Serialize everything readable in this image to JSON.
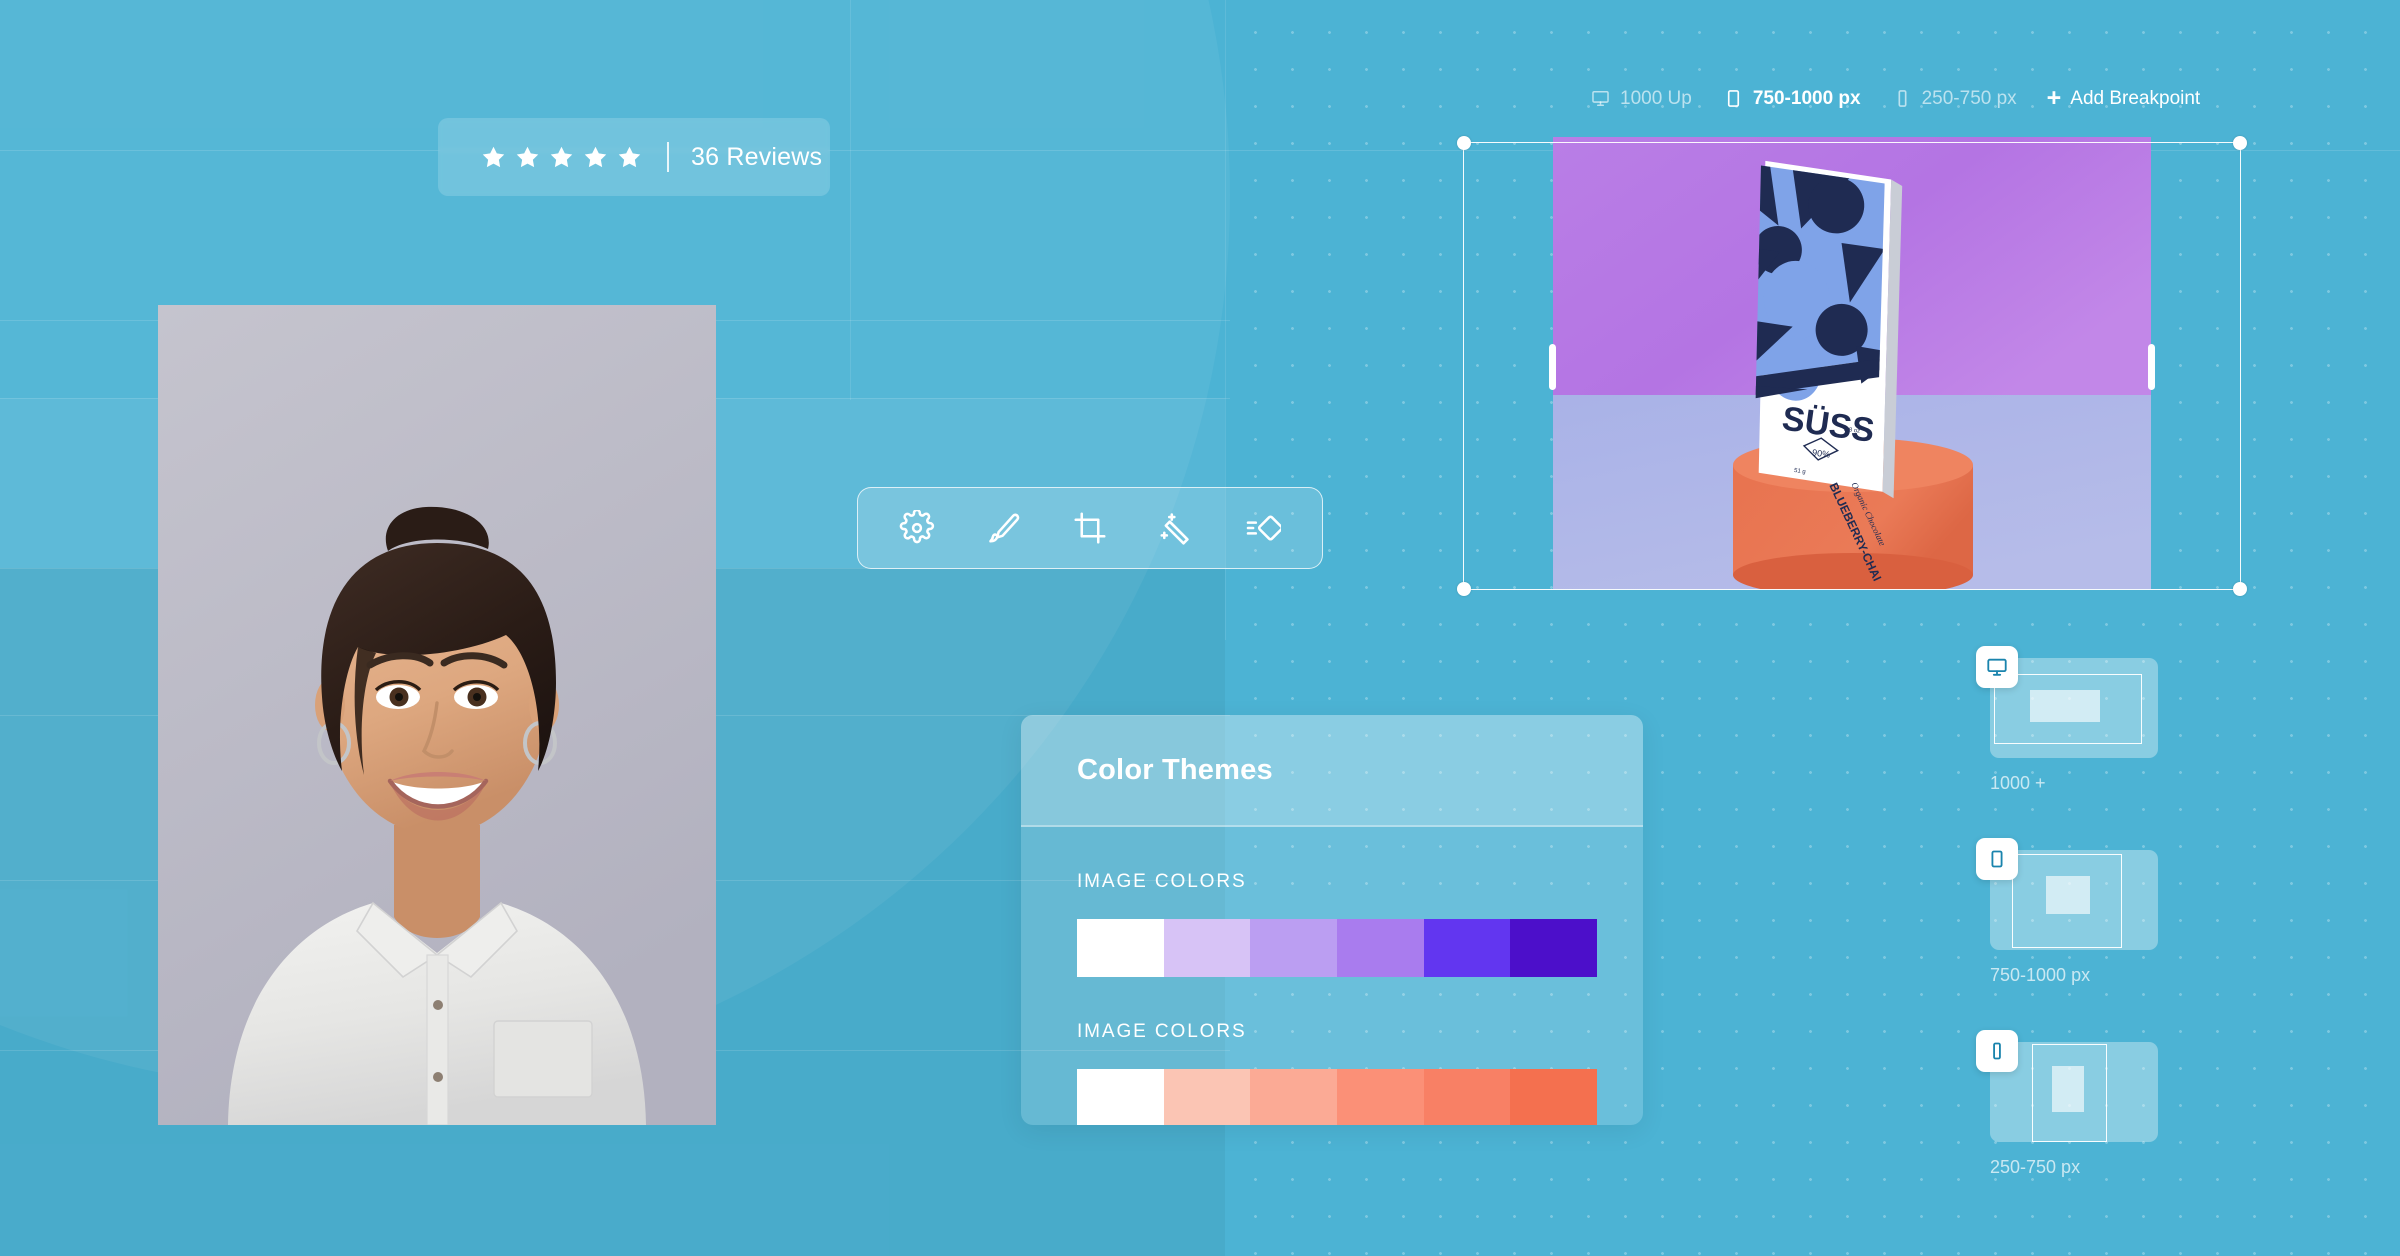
{
  "theme": {
    "background": "#4cb3d4",
    "panel_overlay": "rgba(255,255,255,0.17)",
    "accent_icon": "#1a84ad",
    "text_on_blue": "#ffffff"
  },
  "reviews_badge": {
    "star_count": 5,
    "star_icon": "star-icon",
    "divider": "|",
    "text": "36 Reviews"
  },
  "portrait": {
    "alt": "Smiling woman in light grey denim shirt on grey background",
    "background": "#bdbcc8"
  },
  "edit_toolbar": {
    "tools": [
      {
        "icon": "settings-gear-icon",
        "label": "Settings"
      },
      {
        "icon": "paint-brush-icon",
        "label": "Brush"
      },
      {
        "icon": "crop-icon",
        "label": "Crop"
      },
      {
        "icon": "magic-wand-icon",
        "label": "Magic Wand"
      },
      {
        "icon": "adjust-filter-icon",
        "label": "Adjust"
      }
    ]
  },
  "breakpoint_bar": {
    "items": [
      {
        "icon": "desktop-monitor-icon",
        "label": "1000 Up",
        "active": false
      },
      {
        "icon": "tablet-icon",
        "label": "750-1000 px",
        "active": true
      },
      {
        "icon": "mobile-phone-icon",
        "label": "250-750 px",
        "active": false
      }
    ],
    "add": {
      "plus": "+",
      "label": "Add Breakpoint"
    }
  },
  "canvas": {
    "product": {
      "brand": "SÜSS",
      "flavor": "BLUEBERRY-CHAI",
      "subtitle": "Organic Chocolate",
      "cacao": "90%",
      "weight": "1.8 oz",
      "net": "51 g",
      "backdrop_top": "#b277e0",
      "backdrop_bottom": "#aab3e6",
      "pedestal": "#e8734f",
      "wrap_dark": "#1f2b52",
      "wrap_light": "#7fa3e8"
    },
    "selection": {
      "handle_icon": "resize-handle-icon",
      "edge_icon": "resize-edge-handle-icon"
    }
  },
  "color_themes": {
    "title": "Color Themes",
    "groups": [
      {
        "label": "IMAGE COLORS",
        "swatches": [
          "#ffffff",
          "#d7c3f6",
          "#bb9ef2",
          "#a97cee",
          "#6236f0",
          "#4c0fca"
        ]
      },
      {
        "label": "IMAGE COLORS",
        "swatches": [
          "#ffffff",
          "#fbc5b4",
          "#fbaa95",
          "#fb9077",
          "#f88065",
          "#f4704f"
        ]
      }
    ]
  },
  "responsive_previews": [
    {
      "icon": "desktop-monitor-icon",
      "caption": "1000 +",
      "kind": "desktop"
    },
    {
      "icon": "tablet-icon",
      "caption": "750-1000 px",
      "kind": "tablet"
    },
    {
      "icon": "mobile-phone-icon",
      "caption": "250-750 px",
      "kind": "mobile"
    }
  ]
}
